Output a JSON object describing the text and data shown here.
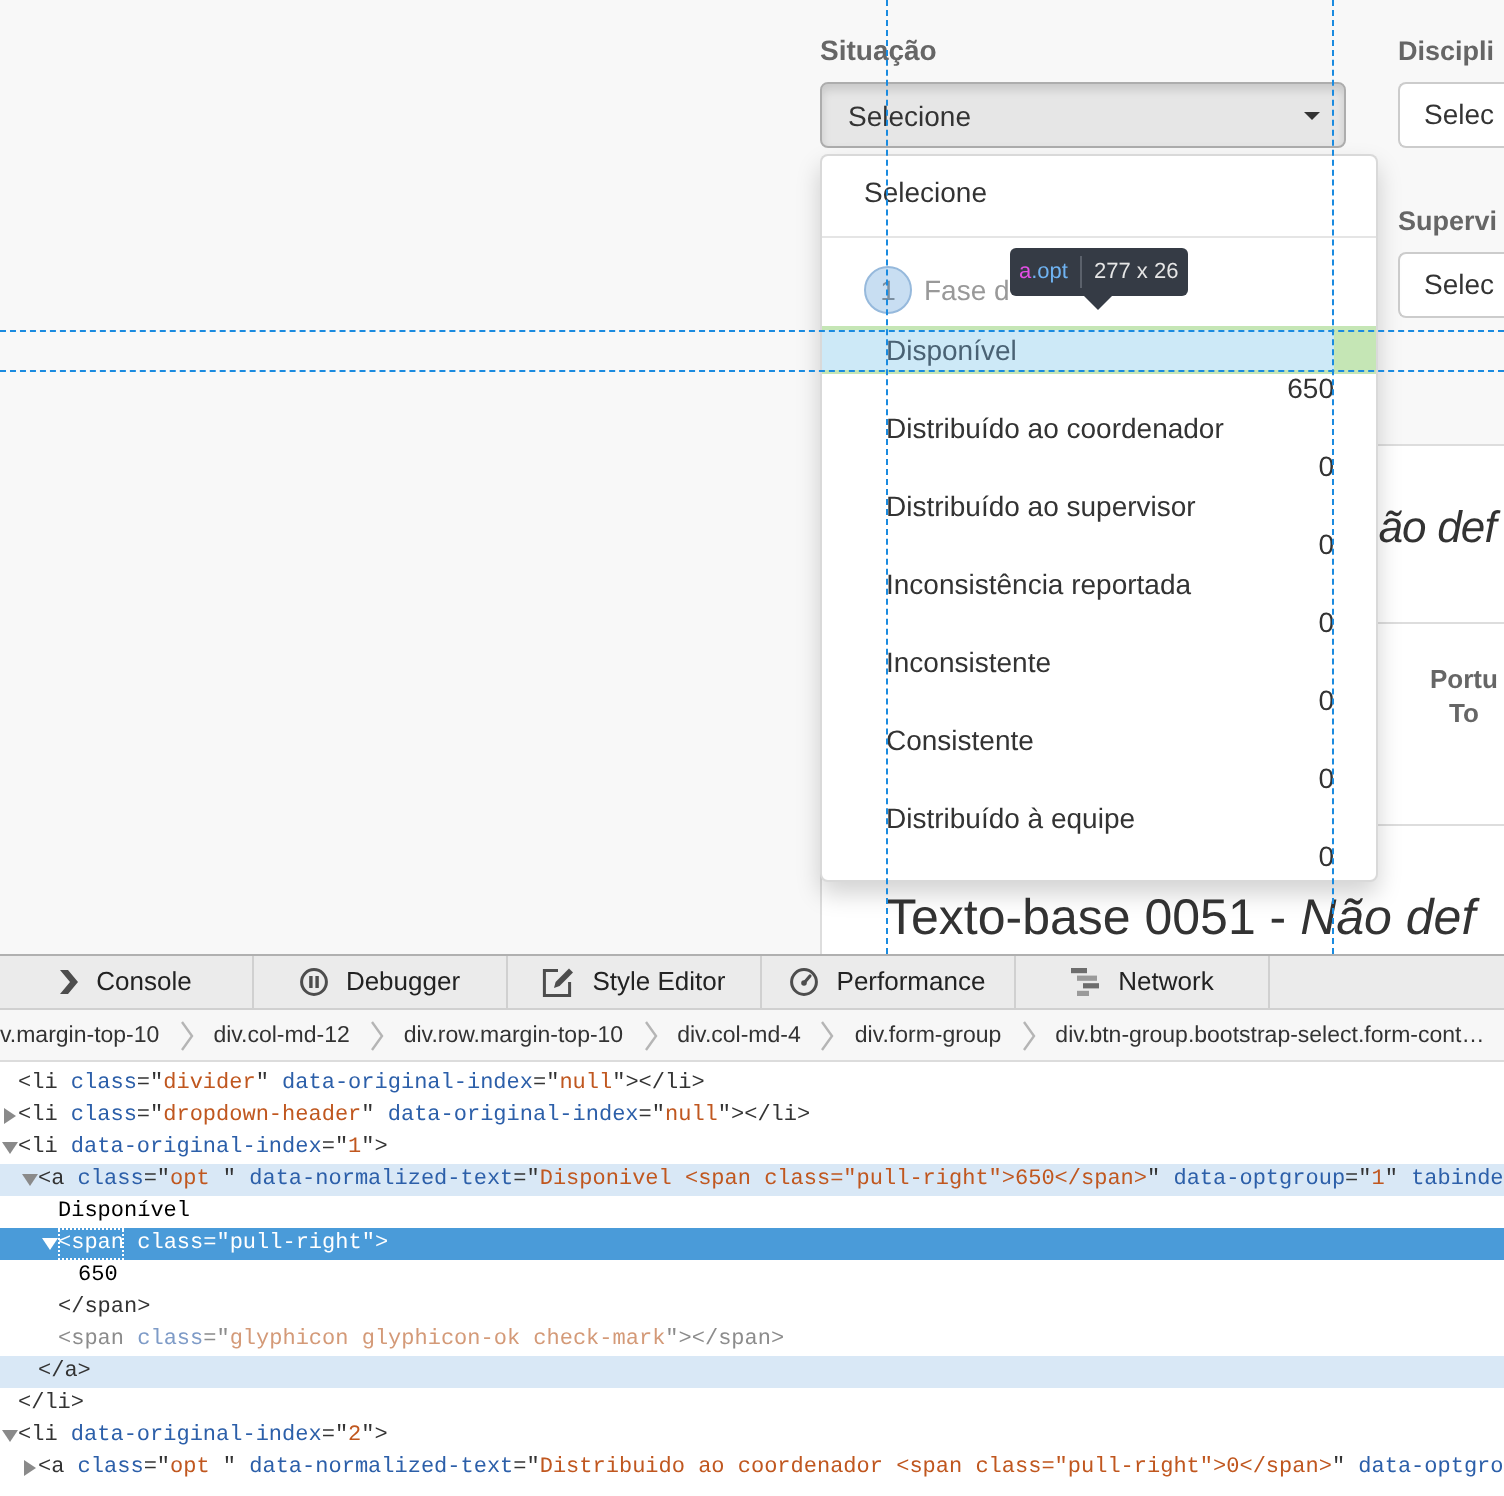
{
  "filters": [
    [
      {
        "kind": "select",
        "label": "Situação",
        "value": "Selecione",
        "expanded": true,
        "menu": {
          "items": [
            {
              "kind": "option",
              "label": "Selecione",
              "highlighted": false
            },
            {
              "kind": "divider"
            },
            {
              "kind": "header",
              "badge": "1",
              "label": "Fase d",
              "children": [
                {
                  "kind": "option",
                  "label": "Disponível",
                  "count": "650",
                  "highlighted": true
                },
                {
                  "kind": "option",
                  "label": "Distribuído ao coordenador",
                  "count": "0",
                  "highlighted": false
                },
                {
                  "kind": "option",
                  "label": "Distribuído ao supervisor",
                  "count": "0",
                  "highlighted": false
                },
                {
                  "kind": "option",
                  "label": "Inconsistência reportada",
                  "count": "0",
                  "highlighted": false
                },
                {
                  "kind": "option",
                  "label": "Inconsistente",
                  "count": "0",
                  "highlighted": false
                },
                {
                  "kind": "option",
                  "label": "Consistente",
                  "count": "0",
                  "highlighted": false
                },
                {
                  "kind": "option",
                  "label": "Distribuído à equipe",
                  "count": "0",
                  "highlighted": false
                }
              ]
            }
          ]
        }
      }
    ],
    [
      {
        "kind": "input",
        "label": "Discipli",
        "value": "Selec"
      },
      {
        "kind": "input",
        "label": "Supervi",
        "value": "Selec"
      }
    ]
  ],
  "tooltip": {
    "selector_tag": "a",
    "selector_class": ".opt",
    "size": "277 x 26"
  },
  "content": {
    "heading_1": "ão def",
    "table_header": "Portu To",
    "heading_2": "Texto-base 0051 - *Não def*"
  },
  "devtools": {
    "tabs": [
      {
        "kind": "console",
        "label": "Console",
        "selected": false
      },
      {
        "kind": "debugger",
        "label": "Debugger",
        "selected": false
      },
      {
        "kind": "editor",
        "label": "Style Editor",
        "selected": false
      },
      {
        "kind": "performance",
        "label": "Performance",
        "selected": false
      },
      {
        "kind": "network",
        "label": "Network",
        "selected": false
      }
    ],
    "breadcrumbs": [
      "v.margin-top-10",
      "div.col-md-12",
      "div.row.margin-top-10",
      "div.col-md-4",
      "div.form-group",
      "div.btn-group.bootstrap-select.form-cont…"
    ],
    "markup": [
      {
        "open": [
          {
            "kind": "tag",
            "text": "<li"
          },
          {
            "kind": "attr",
            "text": " class"
          },
          {
            "kind": "tag",
            "text": "=\""
          },
          {
            "kind": "value",
            "text": "divider"
          },
          {
            "kind": "tag",
            "text": "\""
          },
          {
            "kind": "attr",
            "text": " data-original-index"
          },
          {
            "kind": "tag",
            "text": "=\""
          },
          {
            "kind": "value",
            "text": "null"
          },
          {
            "kind": "tag",
            "text": "\"></li>"
          }
        ],
        "selected": false,
        "hovered": false,
        "dimmed": false
      },
      {
        "open": [
          {
            "kind": "tag",
            "text": "<li"
          },
          {
            "kind": "attr",
            "text": " class"
          },
          {
            "kind": "tag",
            "text": "=\""
          },
          {
            "kind": "value",
            "text": "dropdown-header"
          },
          {
            "kind": "tag",
            "text": "\""
          },
          {
            "kind": "attr",
            "text": " data-original-index"
          },
          {
            "kind": "tag",
            "text": "=\""
          },
          {
            "kind": "value",
            "text": "null"
          },
          {
            "kind": "tag",
            "text": "\"></li>"
          }
        ],
        "expanded": false,
        "selected": false,
        "hovered": false,
        "dimmed": false
      },
      {
        "open": [
          {
            "kind": "tag",
            "text": "<li"
          },
          {
            "kind": "attr",
            "text": " data-original-index"
          },
          {
            "kind": "tag",
            "text": "=\""
          },
          {
            "kind": "value",
            "text": "1"
          },
          {
            "kind": "tag",
            "text": "\">"
          }
        ],
        "expanded": true,
        "selected": false,
        "hovered": false,
        "dimmed": false,
        "children": [
          {
            "open": [
              {
                "kind": "tag",
                "text": "<a"
              },
              {
                "kind": "attr",
                "text": " class"
              },
              {
                "kind": "tag",
                "text": "=\""
              },
              {
                "kind": "value",
                "text": "opt "
              },
              {
                "kind": "tag",
                "text": "\""
              },
              {
                "kind": "attr",
                "text": " data-normalized-text"
              },
              {
                "kind": "tag",
                "text": "=\""
              },
              {
                "kind": "value",
                "text": "Disponivel <span class=\"pull-right\">650</span>"
              },
              {
                "kind": "tag",
                "text": "\""
              },
              {
                "kind": "attr",
                "text": " data-optgroup"
              },
              {
                "kind": "tag",
                "text": "=\""
              },
              {
                "kind": "value",
                "text": "1"
              },
              {
                "kind": "tag",
                "text": "\""
              },
              {
                "kind": "attr",
                "text": " tabinde"
              }
            ],
            "expanded": true,
            "selected": false,
            "hovered": true,
            "dimmed": false,
            "children": [
              {
                "open": [
                  {
                    "kind": "text",
                    "text": "Disponível"
                  }
                ],
                "selected": false,
                "hovered": false,
                "dimmed": false
              },
              {
                "open": [
                  {
                    "kind": "tag",
                    "text": "<span"
                  },
                  {
                    "kind": "attr",
                    "text": " class"
                  },
                  {
                    "kind": "tag",
                    "text": "=\""
                  },
                  {
                    "kind": "value",
                    "text": "pull-right"
                  },
                  {
                    "kind": "tag",
                    "text": "\">"
                  }
                ],
                "expanded": true,
                "selected": true,
                "hovered": false,
                "dimmed": false,
                "children": [
                  {
                    "open": [
                      {
                        "kind": "text",
                        "text": "650"
                      }
                    ],
                    "selected": false,
                    "hovered": false,
                    "dimmed": false
                  }
                ],
                "close": [
                  {
                    "kind": "tag",
                    "text": "</span>"
                  }
                ]
              },
              {
                "open": [
                  {
                    "kind": "tag",
                    "text": "<span"
                  },
                  {
                    "kind": "attr",
                    "text": " class"
                  },
                  {
                    "kind": "tag",
                    "text": "=\""
                  },
                  {
                    "kind": "value",
                    "text": "glyphicon glyphicon-ok check-mark"
                  },
                  {
                    "kind": "tag",
                    "text": "\"></span>"
                  }
                ],
                "selected": false,
                "hovered": false,
                "dimmed": true
              }
            ],
            "close": [
              {
                "kind": "tag",
                "text": "</a>"
              }
            ]
          }
        ],
        "close": [
          {
            "kind": "tag",
            "text": "</li>"
          }
        ]
      },
      {
        "open": [
          {
            "kind": "tag",
            "text": "<li"
          },
          {
            "kind": "attr",
            "text": " data-original-index"
          },
          {
            "kind": "tag",
            "text": "=\""
          },
          {
            "kind": "value",
            "text": "2"
          },
          {
            "kind": "tag",
            "text": "\">"
          }
        ],
        "expanded": true,
        "selected": false,
        "hovered": false,
        "dimmed": false,
        "children": [
          {
            "open": [
              {
                "kind": "tag",
                "text": "<a"
              },
              {
                "kind": "attr",
                "text": " class"
              },
              {
                "kind": "tag",
                "text": "=\""
              },
              {
                "kind": "value",
                "text": "opt "
              },
              {
                "kind": "tag",
                "text": "\""
              },
              {
                "kind": "attr",
                "text": " data-normalized-text"
              },
              {
                "kind": "tag",
                "text": "=\""
              },
              {
                "kind": "value",
                "text": "Distribuido ao coordenador <span class=\"pull-right\">0</span>"
              },
              {
                "kind": "tag",
                "text": "\""
              },
              {
                "kind": "attr",
                "text": " data-optgro"
              }
            ],
            "expanded": false,
            "selected": false,
            "hovered": false,
            "dimmed": false
          }
        ]
      }
    ]
  }
}
